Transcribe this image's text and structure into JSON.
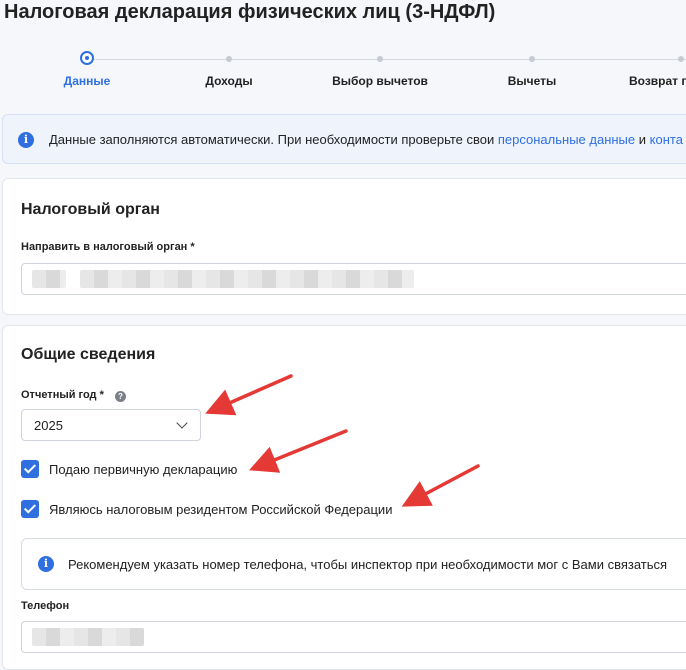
{
  "page": {
    "title": "Налоговая декларация физических лиц (3-НДФЛ)"
  },
  "stepper": {
    "steps": [
      {
        "label": "Данные",
        "active": true
      },
      {
        "label": "Доходы",
        "active": false
      },
      {
        "label": "Выбор вычетов",
        "active": false
      },
      {
        "label": "Вычеты",
        "active": false
      },
      {
        "label": "Возврат по",
        "active": false
      }
    ]
  },
  "info": {
    "icon": "info-icon",
    "text_before": "Данные заполняются автоматически. При необходимости проверьте свои ",
    "link1": "персональные данные",
    "text_mid": " и ",
    "link2": "конта"
  },
  "tax_office": {
    "title": "Налоговый орган",
    "field_label": "Направить в налоговый орган *"
  },
  "general": {
    "title": "Общие сведения",
    "year_label": "Отчетный год *",
    "year_value": "2025",
    "checkbox_primary": "Подаю первичную декларацию",
    "checkbox_resident": "Являюсь налоговым резидентом Российской Федерации",
    "note_text": "Рекомендуем указать номер телефона, чтобы инспектор при необходимости мог с Вами связаться",
    "phone_label": "Телефон"
  },
  "colors": {
    "accent": "#2f6fe0",
    "arrow": "#e53935"
  }
}
